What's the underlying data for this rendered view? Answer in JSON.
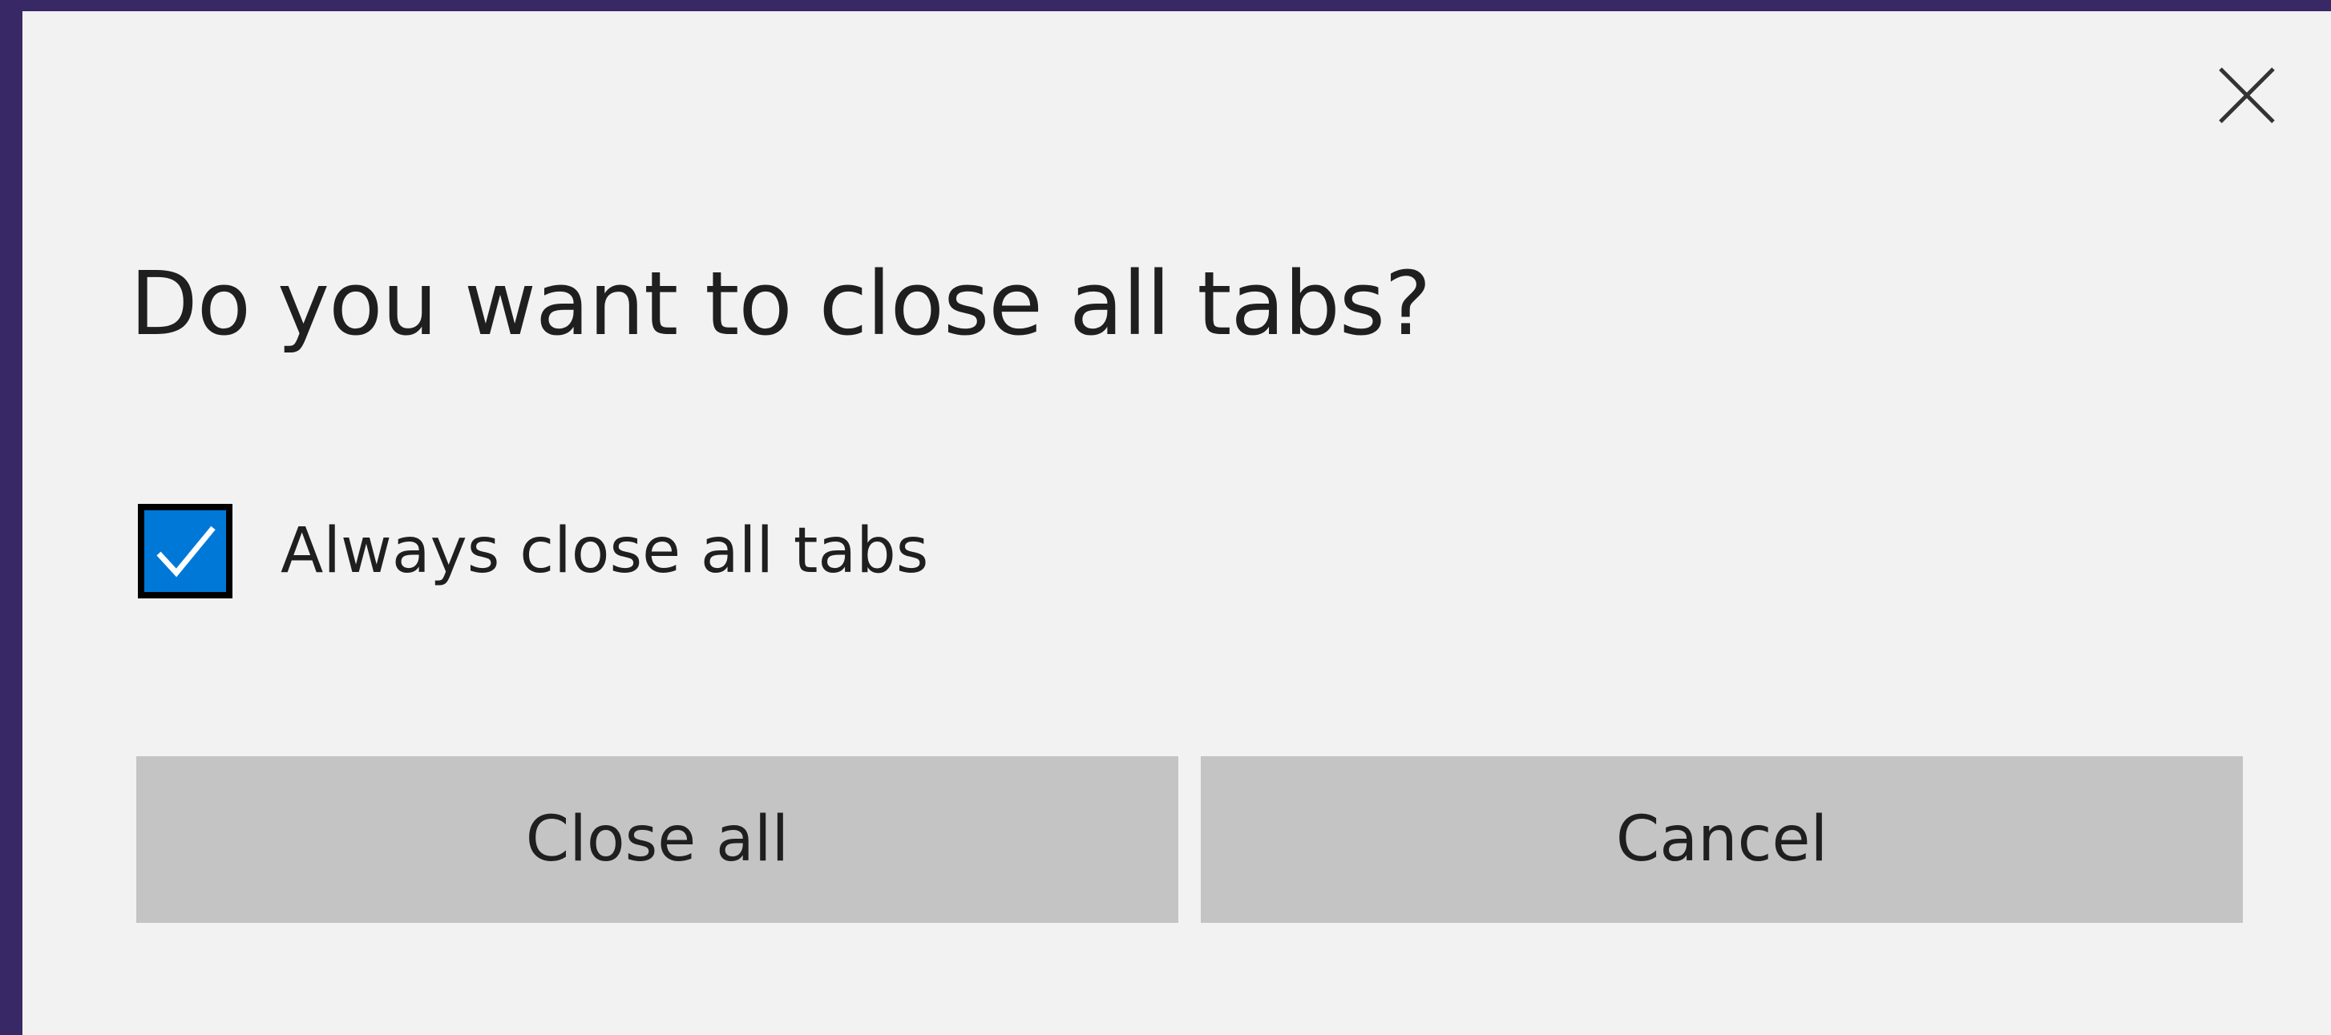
{
  "dialog": {
    "title": "Do you want to close all tabs?",
    "close_icon": "close-icon",
    "option": {
      "label": "Always close all tabs",
      "checked": true,
      "check_icon": "checkmark-icon"
    },
    "buttons": {
      "primary": "Close all",
      "secondary": "Cancel"
    }
  },
  "colors": {
    "background_frame": "#382866",
    "dialog_background": "#f2f2f2",
    "checkbox_fill": "#0078d7",
    "button_background": "#c4c4c4"
  }
}
